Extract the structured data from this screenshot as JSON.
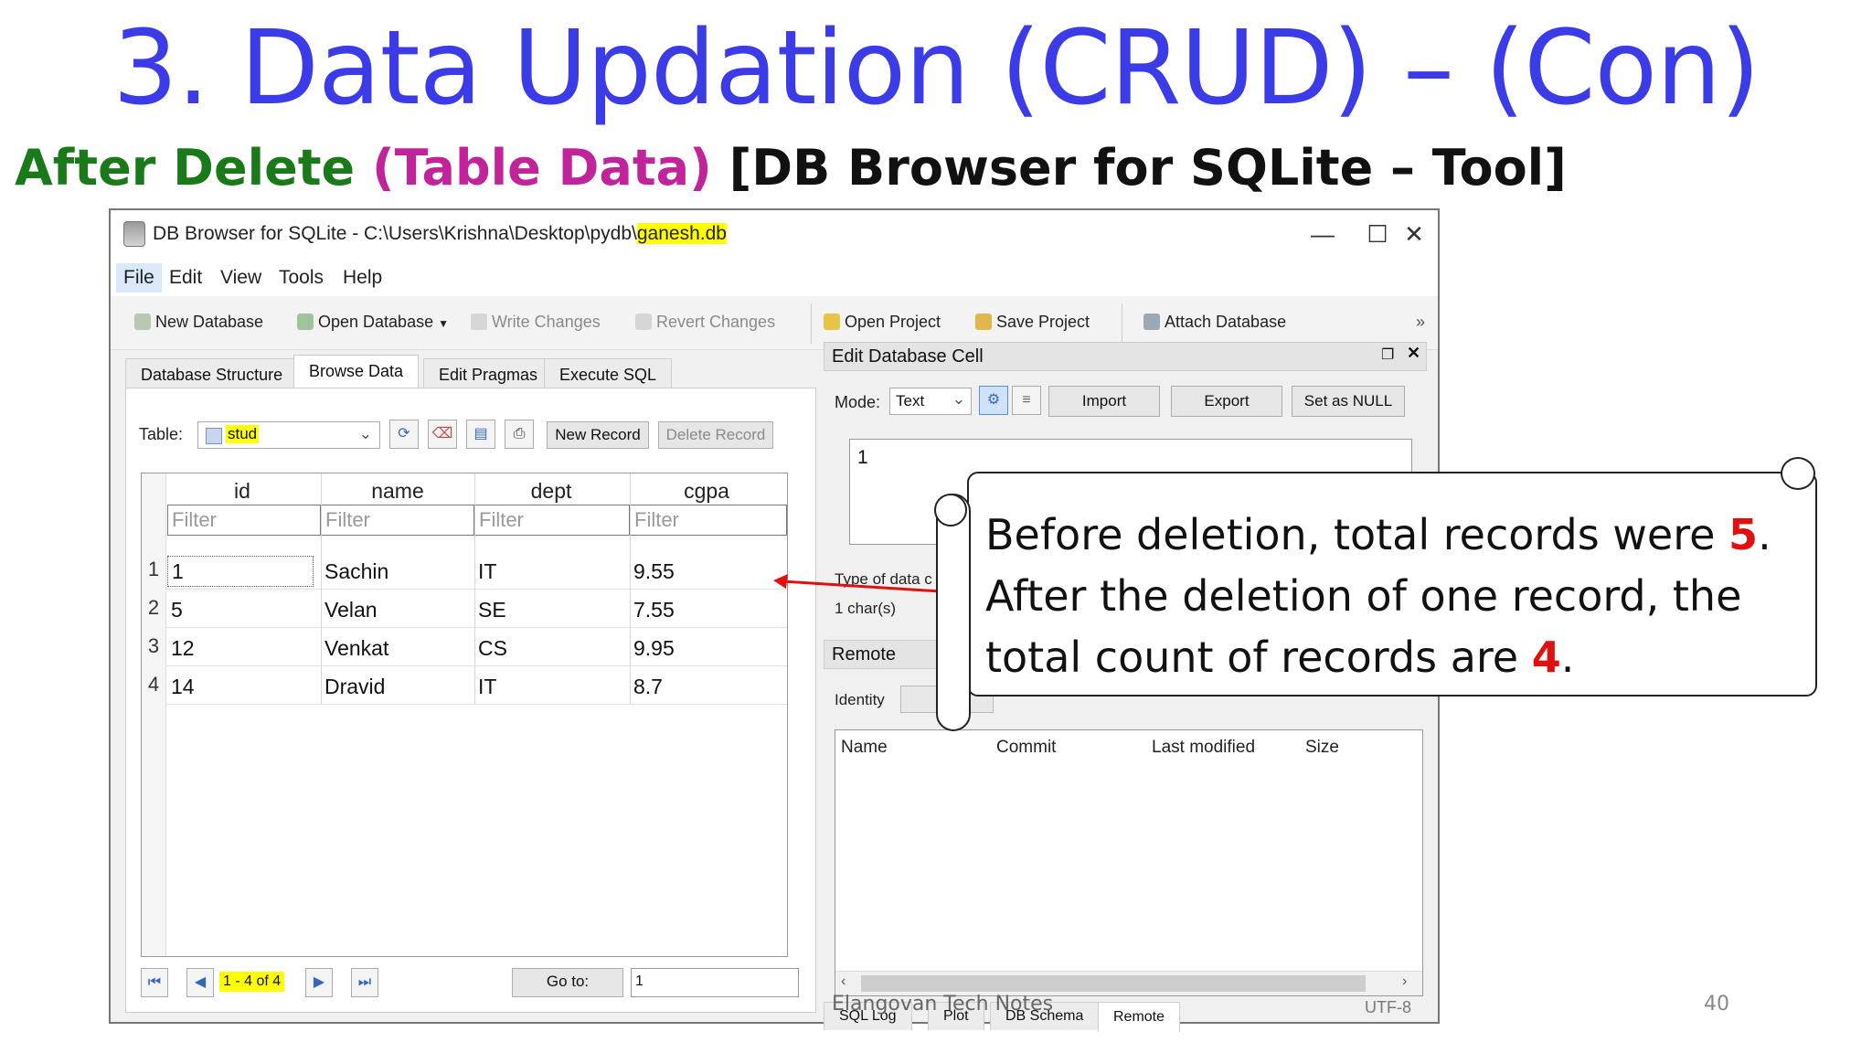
{
  "slide": {
    "title": "3. Data Updation (CRUD) – (Con)",
    "subtitle_part1": "After Delete",
    "subtitle_part2": "(Table Data)",
    "subtitle_part3": "[DB Browser for SQLite – Tool]",
    "footer": "Elangovan Tech Notes",
    "page_number": "40",
    "colors": {
      "title": "#3b3be8",
      "green": "#1a7a1a",
      "magenta": "#c0239a",
      "highlight": "#ffff00",
      "red": "#e01010"
    }
  },
  "window": {
    "title_prefix": "DB Browser for SQLite - C:\\Users\\Krishna\\Desktop\\pydb\\",
    "title_file": "ganesh.db",
    "minimize": "—",
    "maximize": "☐",
    "close": "✕",
    "menu": [
      "File",
      "Edit",
      "View",
      "Tools",
      "Help"
    ],
    "toolbar": {
      "new_database": "New Database",
      "open_database": "Open Database",
      "write_changes": "Write Changes",
      "revert_changes": "Revert Changes",
      "open_project": "Open Project",
      "save_project": "Save Project",
      "attach_database": "Attach Database",
      "more": "»"
    },
    "tabs": [
      "Database Structure",
      "Browse Data",
      "Edit Pragmas",
      "Execute SQL"
    ],
    "active_tab": "Browse Data",
    "browse": {
      "table_label": "Table:",
      "table_value": "stud",
      "new_record": "New Record",
      "delete_record": "Delete Record",
      "columns": [
        "id",
        "name",
        "dept",
        "cgpa"
      ],
      "filter_placeholder": "Filter",
      "rows": [
        {
          "n": "1",
          "id": "1",
          "name": "Sachin",
          "dept": "IT",
          "cgpa": "9.55"
        },
        {
          "n": "2",
          "id": "5",
          "name": "Velan",
          "dept": "SE",
          "cgpa": "7.55"
        },
        {
          "n": "3",
          "id": "12",
          "name": "Venkat",
          "dept": "CS",
          "cgpa": "9.95"
        },
        {
          "n": "4",
          "id": "14",
          "name": "Dravid",
          "dept": "IT",
          "cgpa": "8.7"
        }
      ],
      "pager_text": "1 - 4 of 4",
      "goto_label": "Go to:",
      "goto_value": "1"
    },
    "edit_cell": {
      "header": "Edit Database Cell",
      "mode_label": "Mode:",
      "mode_value": "Text",
      "import": "Import",
      "export": "Export",
      "set_null": "Set as NULL",
      "cell_value": "1",
      "type_label": "Type of data c",
      "size_label": "1 char(s)"
    },
    "remote": {
      "header": "Remote",
      "identity_label": "Identity",
      "columns": [
        "Name",
        "Commit",
        "Last modified",
        "Size"
      ]
    },
    "bottom_tabs": [
      "SQL Log",
      "Plot",
      "DB Schema",
      "Remote"
    ],
    "status_encoding": "UTF-8"
  },
  "callout": {
    "line1_before": "Before deletion, total records were ",
    "line1_num": "5",
    "line1_after": ".",
    "line2": "After the deletion of one record, the",
    "line3_before": "total count of records are ",
    "line3_num": "4",
    "line3_after": "."
  }
}
